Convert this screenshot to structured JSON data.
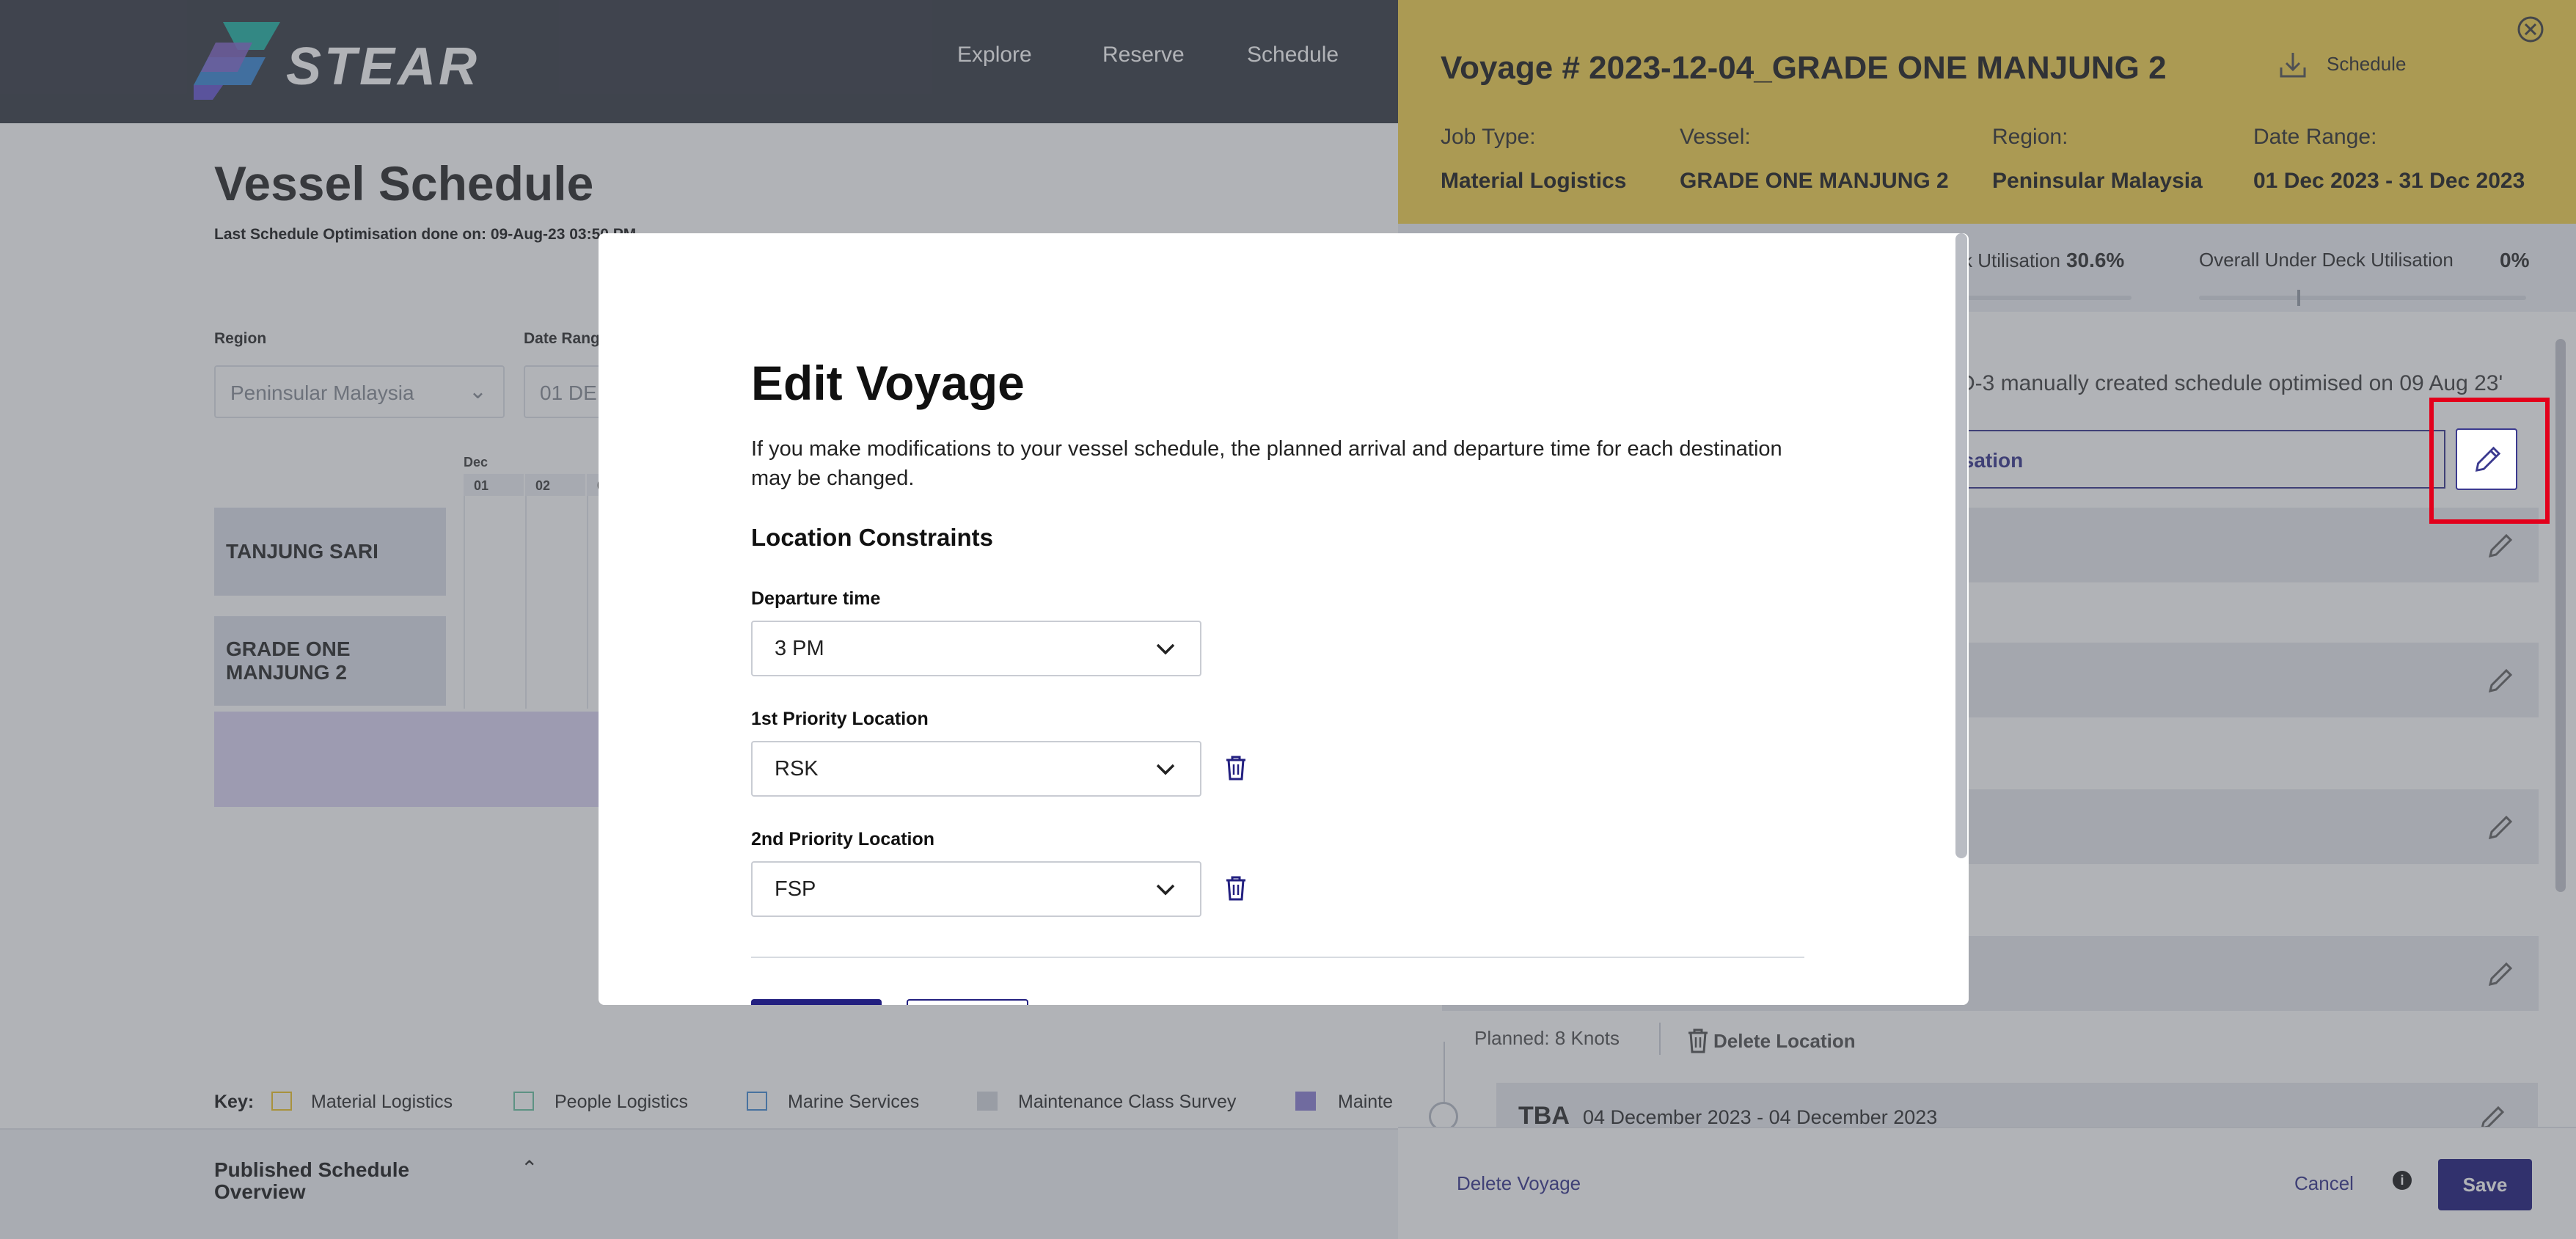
{
  "app": {
    "logo_text": "STEAR",
    "nav": [
      "Explore",
      "Reserve",
      "Schedule"
    ]
  },
  "schedule": {
    "title": "Vessel Schedule",
    "last_optimisation": "Last Schedule Optimisation done on: 09-Aug-23 03:50 PM",
    "region_label": "Region",
    "region_value": "Peninsular Malaysia",
    "date_range_label": "Date Range",
    "date_range_value": "01 DE",
    "month": "Dec",
    "days": [
      "01",
      "02",
      "0"
    ],
    "vessels": [
      "TANJUNG SARI",
      "GRADE ONE MANJUNG 2"
    ]
  },
  "key": {
    "label": "Key:",
    "items": [
      {
        "label": "Material Logistics",
        "color": "#f0c62e"
      },
      {
        "label": "People Logistics",
        "color": "#6fc6a5"
      },
      {
        "label": "Marine Services",
        "color": "#4a8fd6"
      },
      {
        "label": "Maintenance Class Survey",
        "color": "#d6d9e0"
      },
      {
        "label": "Mainte",
        "color": "#8f83d6"
      }
    ]
  },
  "published": {
    "title": "Published Schedule Overview"
  },
  "panel": {
    "voyage_title": "Voyage # 2023-12-04_GRADE ONE MANJUNG 2",
    "schedule_button": "Schedule",
    "meta": [
      {
        "label": "Job Type:",
        "value": "Material Logistics"
      },
      {
        "label": "Vessel:",
        "value": "GRADE ONE MANJUNG 2"
      },
      {
        "label": "Region:",
        "value": "Peninsular Malaysia"
      },
      {
        "label": "Date Range:",
        "value": "01 Dec 2023 - 31 Dec 2023"
      }
    ],
    "deck_util_label": "k Utilisation",
    "deck_util_value": "30.6%",
    "under_deck_label": "Overall Under Deck Utilisation",
    "under_deck_value": "0%",
    "optim_note": "D-3 manually created schedule optimised on 09 Aug 23'",
    "optim_box_text": "isation",
    "planned_speed": "Planned: 8 Knots",
    "delete_location": "Delete Location",
    "tba_name": "TBA",
    "tba_date": "04 December 2023 - 04 December 2023",
    "delete_voyage": "Delete Voyage",
    "cancel": "Cancel",
    "save": "Save"
  },
  "modal": {
    "title": "Edit Voyage",
    "description": "If you make modifications to your vessel schedule, the planned arrival and departure time for each destination may be changed.",
    "subheading": "Location Constraints",
    "departure_label": "Departure time",
    "departure_value": "3 PM",
    "priority1_label": "1st Priority Location",
    "priority1_value": "RSK",
    "priority2_label": "2nd Priority Location",
    "priority2_value": "FSP"
  }
}
